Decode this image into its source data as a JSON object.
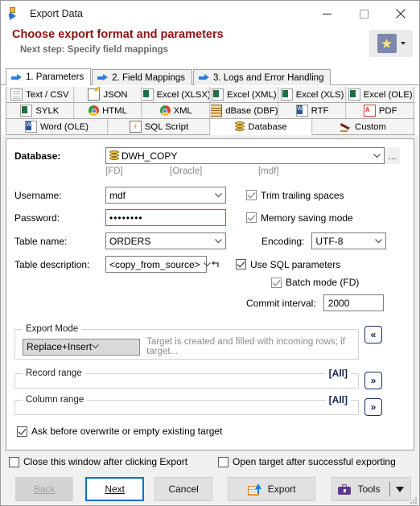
{
  "window": {
    "title": "Export Data",
    "icon": "export-data-icon",
    "minimize": "minimize-icon",
    "maximize": "maximize-icon",
    "close": "close-icon"
  },
  "header": {
    "title": "Choose export format and parameters",
    "subtitle": "Next step: Specify field mappings",
    "favorite_icon": "star-icon"
  },
  "step_tabs": [
    {
      "label": "1. Parameters",
      "active": true
    },
    {
      "label": "2. Field Mappings",
      "active": false
    },
    {
      "label": "3. Logs and Error Handling",
      "active": false
    }
  ],
  "format_tabs": [
    [
      {
        "label": "Text / CSV",
        "icon": "document-icon",
        "selected": false
      },
      {
        "label": "JSON",
        "icon": "json-icon",
        "selected": false
      },
      {
        "label": "Excel (XLSX)",
        "icon": "excel-icon",
        "selected": false
      },
      {
        "label": "Excel (XML)",
        "icon": "excel-icon",
        "selected": false
      },
      {
        "label": "Excel (XLS)",
        "icon": "excel-icon",
        "selected": false
      },
      {
        "label": "Excel (OLE)",
        "icon": "excel-icon",
        "selected": false
      }
    ],
    [
      {
        "label": "SYLK",
        "icon": "excel-icon",
        "selected": false
      },
      {
        "label": "HTML",
        "icon": "chrome-icon",
        "selected": false
      },
      {
        "label": "XML",
        "icon": "chrome-icon",
        "selected": false
      },
      {
        "label": "dBase (DBF)",
        "icon": "dbase-icon",
        "selected": false
      },
      {
        "label": "RTF",
        "icon": "word-icon",
        "selected": false
      },
      {
        "label": "PDF",
        "icon": "pdf-icon",
        "selected": false
      }
    ],
    [
      {
        "label": "Word (OLE)",
        "icon": "word-icon",
        "selected": false
      },
      {
        "label": "SQL Script",
        "icon": "sql-script-icon",
        "selected": false
      },
      {
        "label": "Database",
        "icon": "database-icon",
        "selected": true
      },
      {
        "label": "Custom",
        "icon": "pencil-icon",
        "selected": false
      }
    ]
  ],
  "form": {
    "database_label": "Database:",
    "database_value": "DWH_COPY",
    "database_browse": "...",
    "sub_labels": {
      "fd": "[FD]",
      "oracle": "[Oracle]",
      "mdf": "[mdf]"
    },
    "username_label": "Username:",
    "username_value": "mdf",
    "password_label": "Password:",
    "password_value": "••••••••",
    "table_name_label": "Table name:",
    "table_name_value": "ORDERS",
    "table_description_label": "Table description:",
    "table_description_value": "<copy_from_source>",
    "table_description_reset_icon": "undo-arrow-icon",
    "trim_trailing_spaces": {
      "label": "Trim trailing spaces",
      "checked": true
    },
    "memory_saving_mode": {
      "label": "Memory saving mode",
      "checked": true
    },
    "encoding_label": "Encoding:",
    "encoding_value": "UTF-8",
    "use_sql_parameters": {
      "label": "Use SQL parameters",
      "checked": true
    },
    "batch_mode": {
      "label": "Batch mode (FD)",
      "checked": true
    },
    "commit_interval_label": "Commit interval:",
    "commit_interval_value": "2000"
  },
  "export_mode": {
    "caption": "Export Mode",
    "value": "Replace+Insert",
    "hint": "Target is created and filled with incoming rows; if target...",
    "collapse_icon": "double-chevron-left-icon"
  },
  "record_range": {
    "caption": "Record range",
    "value": "[All]",
    "expand_icon": "double-chevron-right-icon"
  },
  "column_range": {
    "caption": "Column range",
    "value": "[All]",
    "expand_icon": "double-chevron-right-icon"
  },
  "ask_before_overwrite": {
    "label": "Ask before overwrite or empty existing target",
    "checked": true
  },
  "bottom_checks": {
    "close_window": {
      "label": "Close this window after clicking Export",
      "checked": false
    },
    "open_target": {
      "label": "Open target after successful exporting",
      "checked": false
    }
  },
  "buttons": {
    "back": "Back",
    "next": "Next",
    "cancel": "Cancel",
    "export": "Export",
    "tools": "Tools"
  },
  "colors": {
    "header_title": "#8e1212",
    "accent_blue": "#0a72d0",
    "nav_button": "#16265e"
  }
}
